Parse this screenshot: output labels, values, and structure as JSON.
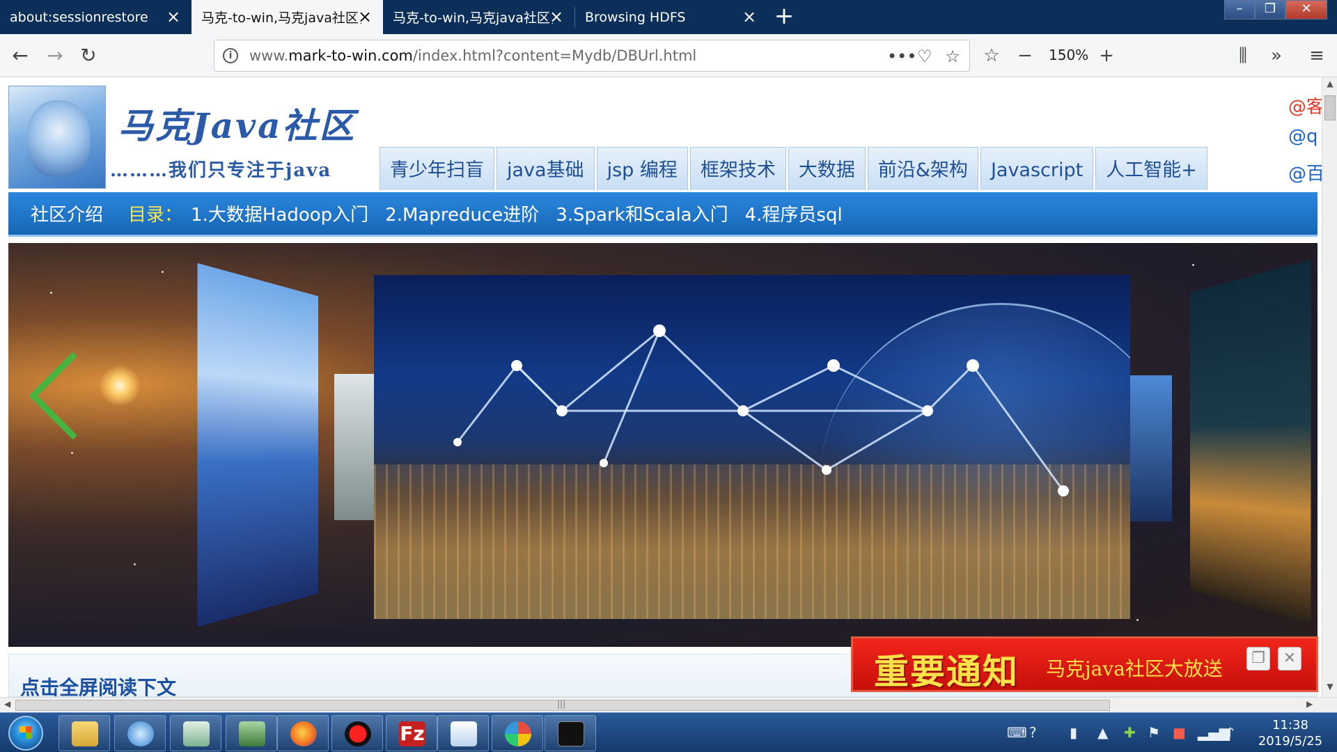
{
  "browser": {
    "tabs": [
      {
        "label": "about:sessionrestore",
        "active": false
      },
      {
        "label": "马克-to-win,马克java社区，mark-",
        "active": true
      },
      {
        "label": "马克-to-win,马克java社区，mark-",
        "active": false
      },
      {
        "label": "Browsing HDFS",
        "active": false
      }
    ],
    "url_prefix": "www.",
    "url_domain": "mark-to-win.com",
    "url_path": "/index.html?content=Mydb/DBUrl.html",
    "zoom": "150%"
  },
  "site": {
    "title": "马克Java社区",
    "subtitle": "………我们只专注于java",
    "top_nav": [
      "青少年扫盲",
      "java基础",
      "jsp 编程",
      "框架技术",
      "大数据",
      "前沿&架构",
      "Javascript",
      "人工智能+"
    ],
    "social": [
      "@客",
      "@q",
      "@百"
    ],
    "bar_intro": "社区介绍",
    "bar_toc_label": "目录：",
    "bar_links": [
      "1.大数据Hadoop入门",
      "2.Mapreduce进阶",
      "3.Spark和Scala入门",
      "4.程序员sql"
    ],
    "read_more": "点击全屏阅读下文",
    "notice_big": "重要通知",
    "notice_small": "马克java社区大放送"
  },
  "taskbar": {
    "time": "11:38",
    "date": "2019/5/25"
  },
  "colors": {
    "tabstrip": "#0c2f5a",
    "nav_blue": "#2a87dd",
    "link_yellow": "#f6e64f",
    "notice_red": "#e01b14"
  }
}
